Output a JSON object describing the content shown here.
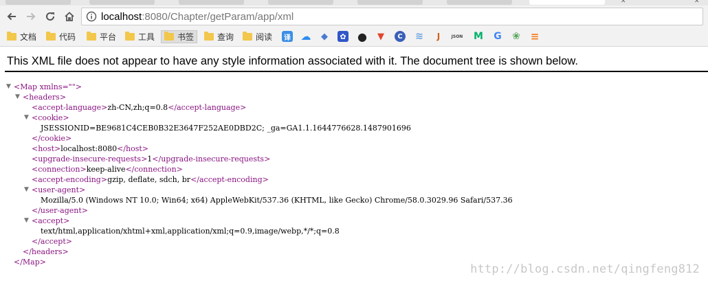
{
  "browser": {
    "url_host": "localhost",
    "url_rest": ":8080/Chapter/getParam/app/xml",
    "bookmarks": [
      {
        "label": "文档",
        "type": "folder"
      },
      {
        "label": "代码",
        "type": "folder"
      },
      {
        "label": "平台",
        "type": "folder"
      },
      {
        "label": "工具",
        "type": "folder"
      },
      {
        "label": "书签",
        "type": "folder"
      },
      {
        "label": "查询",
        "type": "folder"
      },
      {
        "label": "阅读",
        "type": "folder"
      }
    ],
    "bookmark_icons": [
      {
        "name": "translate-icon",
        "glyph": "译",
        "color": "#3b8ee6"
      },
      {
        "name": "cloud-icon",
        "glyph": "☁",
        "color": "#2d8cf0"
      },
      {
        "name": "layers-icon",
        "glyph": "◆",
        "color": "#4a7bd0"
      },
      {
        "name": "paw-icon",
        "glyph": "✿",
        "color": "#3156c8"
      },
      {
        "name": "github-icon",
        "glyph": "●",
        "color": "#222222"
      },
      {
        "name": "gitlab-icon",
        "glyph": "▼",
        "color": "#e2432a"
      },
      {
        "name": "c-logo-icon",
        "glyph": "C",
        "color": "#3a5fb8"
      },
      {
        "name": "stack-icon",
        "glyph": "≋",
        "color": "#6aa3e0"
      },
      {
        "name": "java-icon",
        "glyph": "J",
        "color": "#d0611e"
      },
      {
        "name": "json-icon",
        "glyph": "JSON",
        "color": "#444444"
      },
      {
        "name": "m-logo-icon",
        "glyph": "M",
        "color": "#00b26b"
      },
      {
        "name": "google-icon",
        "glyph": "G",
        "color": "#4285f4"
      },
      {
        "name": "leaf-icon",
        "glyph": "❀",
        "color": "#58a65c"
      },
      {
        "name": "stackoverflow-icon",
        "glyph": "≡",
        "color": "#f48024"
      }
    ]
  },
  "page": {
    "notice": "This XML file does not appear to have any style information associated with it. The document tree is shown below.",
    "watermark": "http://blog.csdn.net/qingfeng812"
  },
  "xml_lines": [
    {
      "i": 0,
      "t": "▼",
      "open": "<Map xmlns=\"\">",
      "text": "",
      "close": ""
    },
    {
      "i": 1,
      "t": "▼",
      "open": "<headers>",
      "text": "",
      "close": ""
    },
    {
      "i": 2,
      "t": "",
      "open": "<accept-language>",
      "text": "zh-CN,zh;q=0.8",
      "close": "</accept-language>"
    },
    {
      "i": 2,
      "t": "▼",
      "open": "<cookie>",
      "text": "",
      "close": ""
    },
    {
      "i": 3,
      "t": "",
      "open": "",
      "text": "JSESSIONID=BE9681C4CEB0B32E3647F252AE0DBD2C; _ga=GA1.1.1644776628.1487901696",
      "close": ""
    },
    {
      "i": 2,
      "t": "",
      "open": "",
      "text": "",
      "close": "</cookie>"
    },
    {
      "i": 2,
      "t": "",
      "open": "<host>",
      "text": "localhost:8080",
      "close": "</host>"
    },
    {
      "i": 2,
      "t": "",
      "open": "<upgrade-insecure-requests>",
      "text": "1",
      "close": "</upgrade-insecure-requests>"
    },
    {
      "i": 2,
      "t": "",
      "open": "<connection>",
      "text": "keep-alive",
      "close": "</connection>"
    },
    {
      "i": 2,
      "t": "",
      "open": "<accept-encoding>",
      "text": "gzip, deflate, sdch, br",
      "close": "</accept-encoding>"
    },
    {
      "i": 2,
      "t": "▼",
      "open": "<user-agent>",
      "text": "",
      "close": ""
    },
    {
      "i": 3,
      "t": "",
      "open": "",
      "text": "Mozilla/5.0 (Windows NT 10.0; Win64; x64) AppleWebKit/537.36 (KHTML, like Gecko) Chrome/58.0.3029.96 Safari/537.36",
      "close": ""
    },
    {
      "i": 2,
      "t": "",
      "open": "",
      "text": "",
      "close": "</user-agent>"
    },
    {
      "i": 2,
      "t": "▼",
      "open": "<accept>",
      "text": "",
      "close": ""
    },
    {
      "i": 3,
      "t": "",
      "open": "",
      "text": "text/html,application/xhtml+xml,application/xml;q=0.9,image/webp,*/*;q=0.8",
      "close": ""
    },
    {
      "i": 2,
      "t": "",
      "open": "",
      "text": "",
      "close": "</accept>"
    },
    {
      "i": 1,
      "t": "",
      "open": "",
      "text": "",
      "close": "</headers>"
    },
    {
      "i": 0,
      "t": "",
      "open": "",
      "text": "",
      "close": "</Map>"
    }
  ]
}
